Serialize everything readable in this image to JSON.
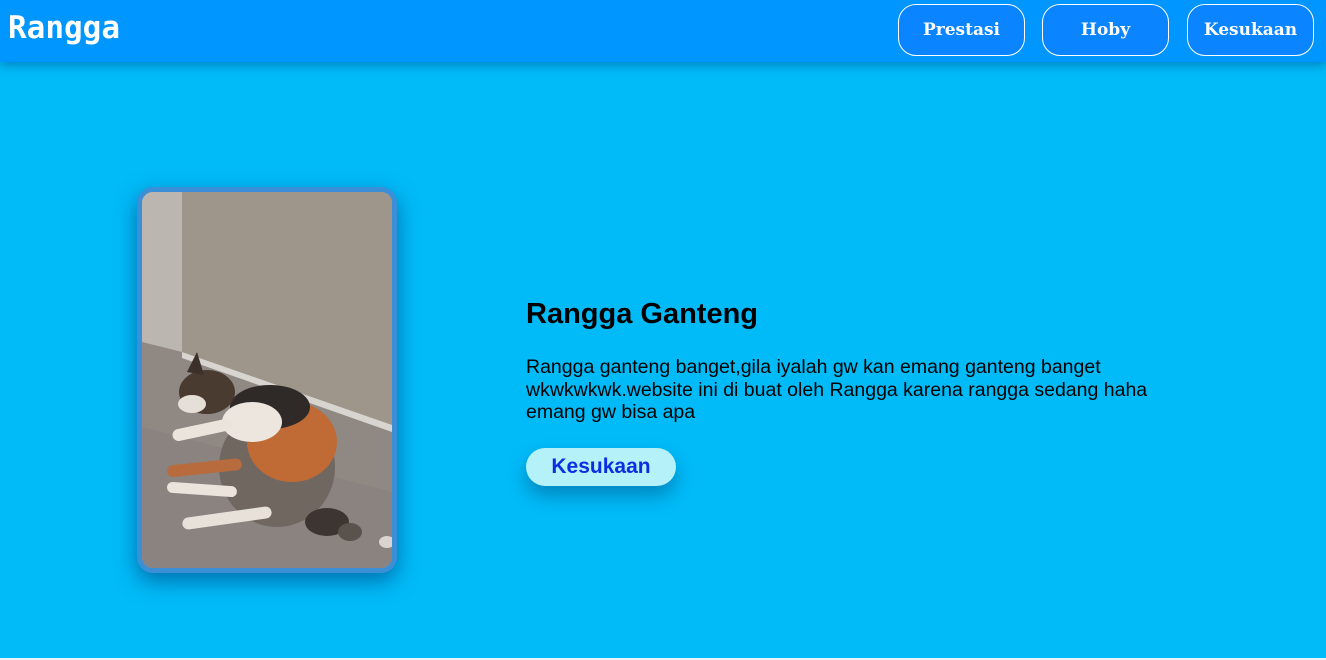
{
  "navbar": {
    "brand": "Rangga",
    "links": [
      {
        "label": "Prestasi"
      },
      {
        "label": "Hoby"
      },
      {
        "label": "Kesukaan"
      }
    ]
  },
  "hero": {
    "photo_subject": "sleeping calico cat",
    "title": "Rangga Ganteng",
    "description": "Rangga ganteng banget,gila iyalah gw kan emang ganteng banget wkwkwkwk.website ini di buat oleh Rangga karena rangga sedang haha emang gw bisa apa",
    "button_label": "Kesukaan"
  },
  "colors": {
    "navbar": "#0096ff",
    "background": "#00bbf8",
    "button_bg": "#b5f1f8",
    "button_text": "#0a2fe0"
  }
}
